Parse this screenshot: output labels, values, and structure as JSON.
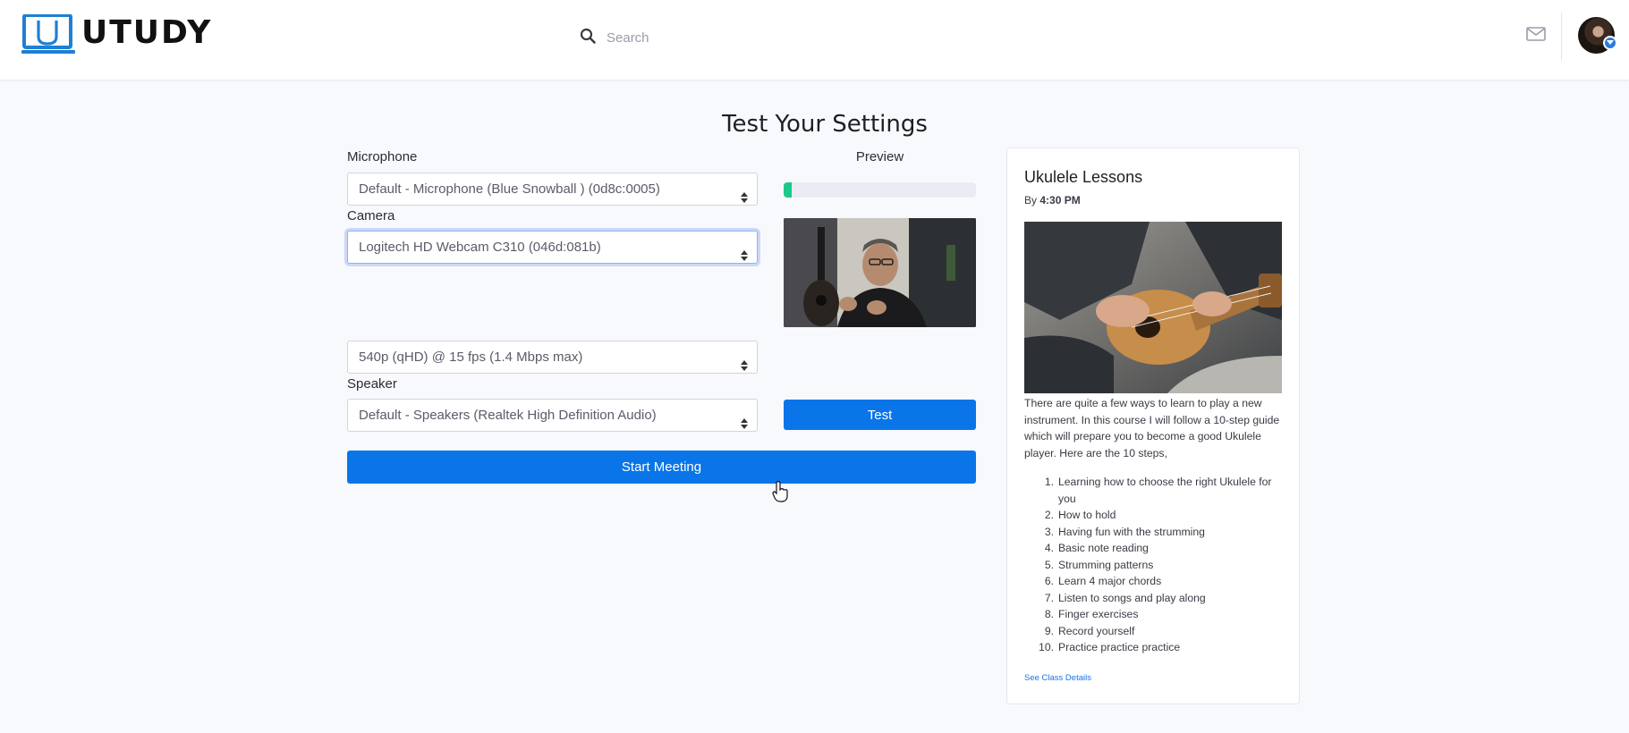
{
  "app": {
    "logo_text": "UTUDY"
  },
  "header": {
    "search_placeholder": "Search",
    "icons": [
      "search-icon",
      "mail-icon",
      "avatar"
    ]
  },
  "page": {
    "title": "Test Your Settings"
  },
  "settings": {
    "microphone_label": "Microphone",
    "microphone_value": "Default - Microphone (Blue Snowball ) (0d8c:0005)",
    "camera_label": "Camera",
    "camera_value": "Logitech HD Webcam C310 (046d:081b)",
    "resolution_value": "540p (qHD) @ 15 fps (1.4 Mbps max)",
    "speaker_label": "Speaker",
    "speaker_value": "Default - Speakers (Realtek High Definition Audio)",
    "preview_label": "Preview",
    "mic_level": 0.04,
    "test_button": "Test",
    "start_button": "Start Meeting"
  },
  "card": {
    "title": "Ukulele Lessons",
    "by_prefix": "By",
    "time": "4:30 PM",
    "description": "There are quite a few ways to learn to play a new instrument. In this course I will follow a 10-step guide which will prepare you to become a good Ukulele player. Here are the 10 steps,",
    "steps": [
      {
        "num": "1.",
        "text": "Learning how to choose the right Ukulele for you"
      },
      {
        "num": "2.",
        "text": "How to hold"
      },
      {
        "num": "3.",
        "text": "Having fun with the strumming"
      },
      {
        "num": "4.",
        "text": "Basic note reading"
      },
      {
        "num": "5.",
        "text": "Strumming patterns"
      },
      {
        "num": "6.",
        "text": "Learn 4 major chords"
      },
      {
        "num": "7.",
        "text": "Listen to songs and play along"
      },
      {
        "num": "8.",
        "text": "Finger exercises"
      },
      {
        "num": "9.",
        "text": "Record yourself"
      },
      {
        "num": "10.",
        "text": "Practice practice practice"
      }
    ],
    "link": "See Class Details"
  },
  "colors": {
    "primary": "#0a75e8",
    "meter": "#1cc88a",
    "background": "#f8f9fc"
  }
}
